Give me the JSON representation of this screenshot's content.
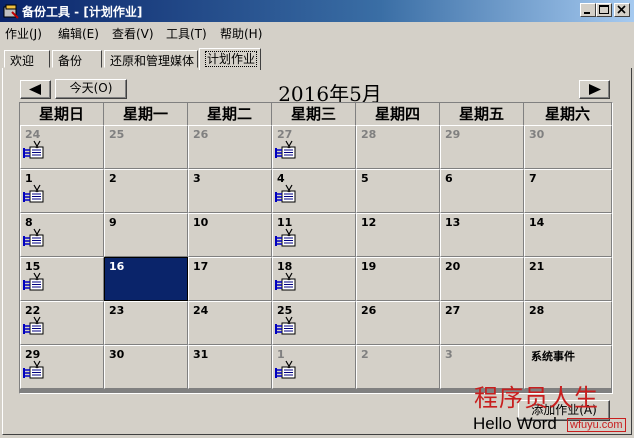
{
  "window": {
    "title": "备份工具 - [计划作业]"
  },
  "menu": [
    "作业(J)",
    "编辑(E)",
    "查看(V)",
    "工具(T)",
    "帮助(H)"
  ],
  "tabs": [
    "欢迎",
    "备份",
    "还原和管理媒体",
    "计划作业"
  ],
  "active_tab": 3,
  "calendar": {
    "month_title": "2016年5月",
    "today_button": "今天(O)",
    "prev_icon": "left-arrow-icon",
    "next_icon": "right-arrow-icon",
    "weekdays": [
      "星期日",
      "星期一",
      "星期二",
      "星期三",
      "星期四",
      "星期五",
      "星期六"
    ],
    "selected_day": "16",
    "weeks": [
      [
        {
          "d": "24",
          "other": true,
          "job": true
        },
        {
          "d": "25",
          "other": true
        },
        {
          "d": "26",
          "other": true
        },
        {
          "d": "27",
          "other": true,
          "job": true
        },
        {
          "d": "28",
          "other": true
        },
        {
          "d": "29",
          "other": true
        },
        {
          "d": "30",
          "other": true
        }
      ],
      [
        {
          "d": "1",
          "job": true
        },
        {
          "d": "2"
        },
        {
          "d": "3"
        },
        {
          "d": "4",
          "job": true
        },
        {
          "d": "5"
        },
        {
          "d": "6"
        },
        {
          "d": "7"
        }
      ],
      [
        {
          "d": "8",
          "job": true
        },
        {
          "d": "9"
        },
        {
          "d": "10"
        },
        {
          "d": "11",
          "job": true
        },
        {
          "d": "12"
        },
        {
          "d": "13"
        },
        {
          "d": "14"
        }
      ],
      [
        {
          "d": "15",
          "job": true
        },
        {
          "d": "16"
        },
        {
          "d": "17"
        },
        {
          "d": "18",
          "job": true
        },
        {
          "d": "19"
        },
        {
          "d": "20"
        },
        {
          "d": "21"
        }
      ],
      [
        {
          "d": "22",
          "job": true
        },
        {
          "d": "23"
        },
        {
          "d": "24"
        },
        {
          "d": "25",
          "job": true
        },
        {
          "d": "26"
        },
        {
          "d": "27"
        },
        {
          "d": "28"
        }
      ],
      [
        {
          "d": "29",
          "job": true
        },
        {
          "d": "30"
        },
        {
          "d": "31"
        },
        {
          "d": "1",
          "other": true,
          "job": true
        },
        {
          "d": "2",
          "other": true
        },
        {
          "d": "3",
          "other": true
        },
        {
          "d": "",
          "event": "系统事件"
        }
      ]
    ],
    "job_icon": "scheduled-backup-job-icon"
  },
  "add_job_button": "添加作业(A)",
  "watermark": {
    "line1": "程序员人生",
    "line2": "Hello Word",
    "site": "wfuyu.com"
  },
  "colors": {
    "title_bar": "#0a246a",
    "selected": "#0a246a",
    "face": "#d4d0c8"
  }
}
